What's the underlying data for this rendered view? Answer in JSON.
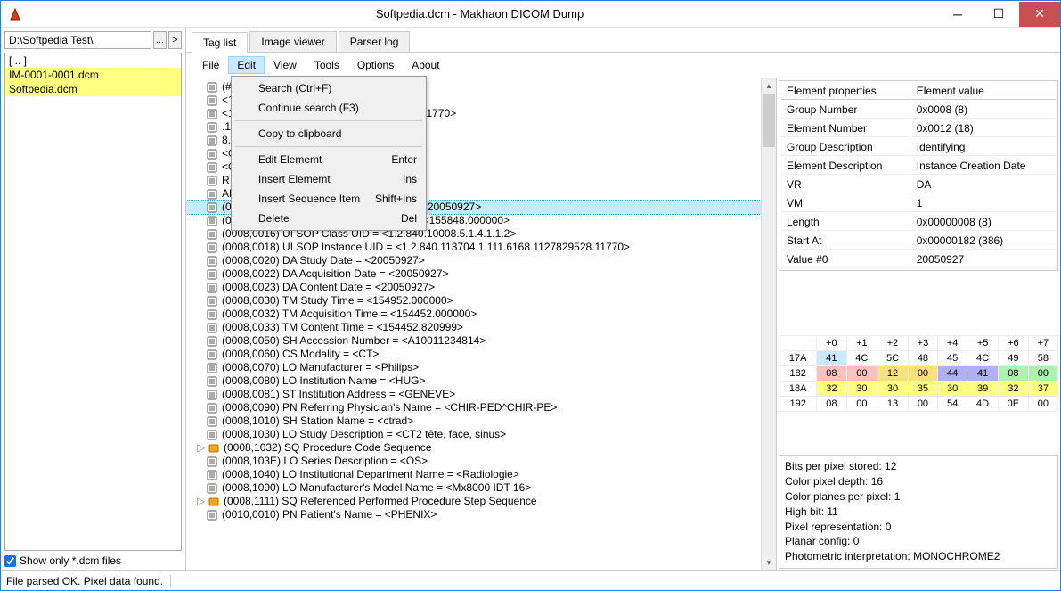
{
  "window": {
    "title": "Softpedia.dcm - Makhaon DICOM Dump"
  },
  "left": {
    "path": "D:\\Softpedia Test\\",
    "files": [
      {
        "name": "[ .. ]",
        "hl": false
      },
      {
        "name": "IM-0001-0001.dcm",
        "hl": true
      },
      {
        "name": "Softpedia.dcm",
        "hl": true
      }
    ],
    "filter_label": "Show only *.dcm files"
  },
  "tabs": [
    {
      "label": "Tag list",
      "active": true
    },
    {
      "label": "Image viewer",
      "active": false
    },
    {
      "label": "Parser log",
      "active": false
    }
  ],
  "menu": {
    "items": [
      "File",
      "Edit",
      "View",
      "Tools",
      "Options",
      "About"
    ],
    "active": 1,
    "dropdown": [
      {
        "label": "Search (Ctrl+F)",
        "shortcut": ""
      },
      {
        "label": "Continue search (F3)",
        "shortcut": ""
      },
      {
        "sep": true
      },
      {
        "label": "Copy to clipboard",
        "shortcut": ""
      },
      {
        "sep": true
      },
      {
        "label": "Edit Elememt",
        "shortcut": "Enter"
      },
      {
        "label": "Insert Elememt",
        "shortcut": "Ins"
      },
      {
        "label": "Insert Sequence Item",
        "shortcut": "Shift+Ins"
      },
      {
        "label": "Delete",
        "shortcut": "Del"
      }
    ]
  },
  "tags": [
    {
      "text": "(#00)(#01)>",
      "icon": "norm"
    },
    {
      "text": "<1.2.840.10008.5.1.4.1.1.2>",
      "icon": "norm"
    },
    {
      "text": "<1.2.840.113704.1.111.6168.1127829528.11770>",
      "icon": "norm"
    },
    {
      "text": ".10008.1.2.1>",
      "icon": "norm"
    },
    {
      "text": "8.6.1.4.1.19291.2.1>",
      "icon": "norm"
    },
    {
      "text": "<OSIRIX001>",
      "icon": "norm"
    },
    {
      "text": "<OSIRIX>",
      "icon": "norm"
    },
    {
      "text": "R 100>",
      "icon": "norm"
    },
    {
      "text": "ARY\\AXIAL\\HELIX>",
      "icon": "norm"
    },
    {
      "text": "(0008,0012) DA Instance Creation Date = <20050927>",
      "icon": "norm",
      "selected": true
    },
    {
      "text": "(0008,0013) TM Instance Creation Time = <155848.000000>",
      "icon": "norm"
    },
    {
      "text": "(0008,0016) UI SOP Class UID = <1.2.840.10008.5.1.4.1.1.2>",
      "icon": "norm"
    },
    {
      "text": "(0008,0018) UI SOP Instance UID = <1.2.840.113704.1.111.6168.1127829528.11770>",
      "icon": "norm"
    },
    {
      "text": "(0008,0020) DA Study Date = <20050927>",
      "icon": "norm"
    },
    {
      "text": "(0008,0022) DA Acquisition Date = <20050927>",
      "icon": "norm"
    },
    {
      "text": "(0008,0023) DA Content Date = <20050927>",
      "icon": "norm"
    },
    {
      "text": "(0008,0030) TM Study Time = <154952.000000>",
      "icon": "norm"
    },
    {
      "text": "(0008,0032) TM Acquisition Time = <154452.000000>",
      "icon": "norm"
    },
    {
      "text": "(0008,0033) TM Content Time = <154452.820999>",
      "icon": "norm"
    },
    {
      "text": "(0008,0050) SH Accession Number = <A10011234814>",
      "icon": "norm"
    },
    {
      "text": "(0008,0060) CS Modality = <CT>",
      "icon": "norm"
    },
    {
      "text": "(0008,0070) LO Manufacturer = <Philips>",
      "icon": "norm"
    },
    {
      "text": "(0008,0080) LO Institution Name = <HUG>",
      "icon": "norm"
    },
    {
      "text": "(0008,0081) ST Institution Address = <GENEVE>",
      "icon": "norm"
    },
    {
      "text": "(0008,0090) PN Referring Physician's Name = <CHIR-PED^CHIR-PE>",
      "icon": "norm"
    },
    {
      "text": "(0008,1010) SH Station Name = <ctrad>",
      "icon": "norm"
    },
    {
      "text": "(0008,1030) LO Study Description = <CT2 tête, face, sinus>",
      "icon": "norm"
    },
    {
      "text": "(0008,1032) SQ Procedure Code Sequence",
      "icon": "seq",
      "toggle": true
    },
    {
      "text": "(0008,103E) LO Series Description = <OS>",
      "icon": "norm"
    },
    {
      "text": "(0008,1040) LO Institutional Department Name = <Radiologie>",
      "icon": "norm"
    },
    {
      "text": "(0008,1090) LO Manufacturer's Model Name = <Mx8000 IDT 16>",
      "icon": "norm"
    },
    {
      "text": "(0008,1111) SQ Referenced Performed Procedure Step Sequence",
      "icon": "seq",
      "toggle": true
    },
    {
      "text": "(0010,0010) PN Patient's Name = <PHENIX>",
      "icon": "norm"
    }
  ],
  "props": {
    "header": [
      "Element properties",
      "Element value"
    ],
    "rows": [
      [
        "Group Number",
        "0x0008 (8)"
      ],
      [
        "Element Number",
        "0x0012 (18)"
      ],
      [
        "Group Description",
        "Identifying"
      ],
      [
        "Element Description",
        "Instance Creation Date"
      ],
      [
        "VR",
        "DA"
      ],
      [
        "VM",
        "1"
      ],
      [
        "Length",
        "0x00000008 (8)"
      ],
      [
        "Start At",
        "0x00000182 (386)"
      ],
      [
        "Value #0",
        "20050927"
      ]
    ]
  },
  "hex": {
    "cols": [
      "",
      "+0",
      "+1",
      "+2",
      "+3",
      "+4",
      "+5",
      "+6",
      "+7"
    ],
    "rows": [
      {
        "addr": "17A",
        "cells": [
          "41",
          "4C",
          "5C",
          "48",
          "45",
          "4C",
          "49",
          "58"
        ],
        "colors": [
          "sel",
          "",
          "",
          "",
          "",
          "",
          "",
          ""
        ]
      },
      {
        "addr": "182",
        "cells": [
          "08",
          "00",
          "12",
          "00",
          "44",
          "41",
          "08",
          "00"
        ],
        "colors": [
          "r",
          "r",
          "y",
          "y",
          "b",
          "b",
          "g",
          "g"
        ]
      },
      {
        "addr": "18A",
        "cells": [
          "32",
          "30",
          "30",
          "35",
          "30",
          "39",
          "32",
          "37"
        ],
        "colors": [
          "yy",
          "yy",
          "yy",
          "yy",
          "yy",
          "yy",
          "yy",
          "yy"
        ]
      },
      {
        "addr": "192",
        "cells": [
          "08",
          "00",
          "13",
          "00",
          "54",
          "4D",
          "0E",
          "00"
        ],
        "colors": [
          "",
          "",
          "",
          "",
          "",
          "",
          "",
          ""
        ]
      }
    ]
  },
  "info": [
    "Bits per pixel stored: 12",
    "Color pixel depth: 16",
    "Color planes per pixel: 1",
    "High bit: 11",
    "Pixel representation: 0",
    "Planar config: 0",
    "Photometric interpretation: MONOCHROME2"
  ],
  "status": "File parsed OK. Pixel data found."
}
